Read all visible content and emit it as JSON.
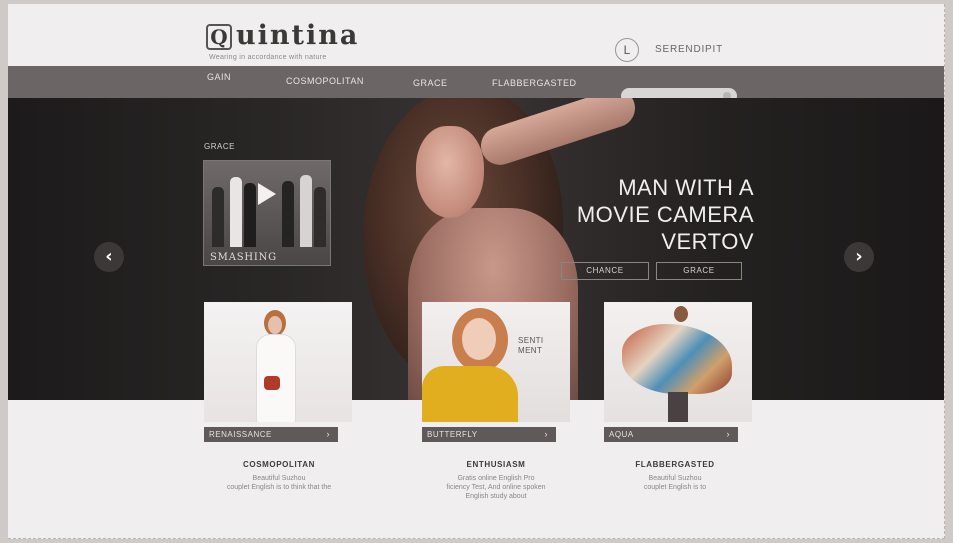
{
  "header": {
    "logo_letter": "Q",
    "logo_rest": "uintina",
    "tagline": "Wearing in accordance with nature",
    "login_letter": "L",
    "brand_link": "SERENDIPIT"
  },
  "nav": {
    "items": [
      "GAIN",
      "COSMOPOLITAN",
      "GRACE",
      "FLABBERGASTED"
    ],
    "search_placeholder": ""
  },
  "hero": {
    "title_lines": [
      "MAN WITH A",
      "MOVIE CAMERA",
      "VERTOV"
    ],
    "buttons": [
      "CHANCE",
      "GRACE"
    ],
    "video_label": "GRACE",
    "video_caption": "SMASHING",
    "prev_glyph": "‹",
    "next_glyph": "›"
  },
  "cards": [
    {
      "bar_label": "RENAISSANCE",
      "title": "COSMOPOLITAN",
      "desc_lines": [
        "Beautiful Suzhou",
        "couplet English is to think that the"
      ]
    },
    {
      "bar_label": "BUTTERFLY",
      "overlay": [
        "SENTI",
        "MENT"
      ],
      "title": "ENTHUSIASM",
      "desc_lines": [
        "Gratis online English Pro",
        "ficiency Test, And online spoken",
        "English study about"
      ]
    },
    {
      "bar_label": "AQUA",
      "title": "FLABBERGASTED",
      "desc_lines": [
        "Beautiful Suzhou",
        "couplet English is to"
      ]
    }
  ],
  "colors": {
    "nav_bg": "#6b6565",
    "hero_bg": "#1c1a1a",
    "card_bar": "#5f5959",
    "page_bg": "#f1eeef"
  }
}
